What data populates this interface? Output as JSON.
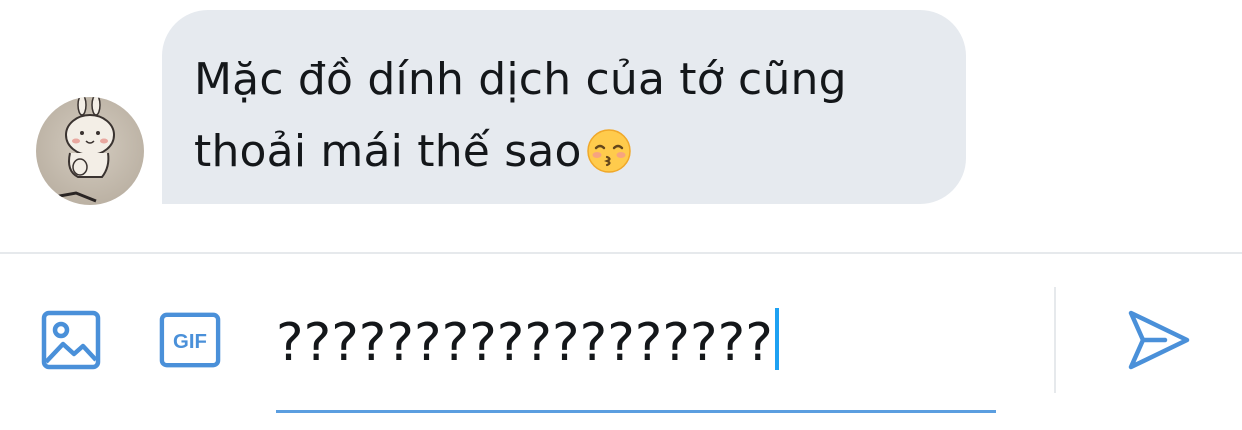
{
  "message": {
    "text_line1": "Mặc đồ dính dịch của tớ cũng",
    "text_line2": "thoải mái thế sao",
    "emoji": "kissing-face-with-closed-eyes"
  },
  "composer": {
    "input_value": "??????????????????",
    "image_icon": "image-icon",
    "gif_label": "GIF",
    "send_icon": "send-icon"
  },
  "colors": {
    "bubble": "#e6eaef",
    "accent": "#4a90d9",
    "text": "#14171a",
    "divider": "#e6e9ec"
  }
}
